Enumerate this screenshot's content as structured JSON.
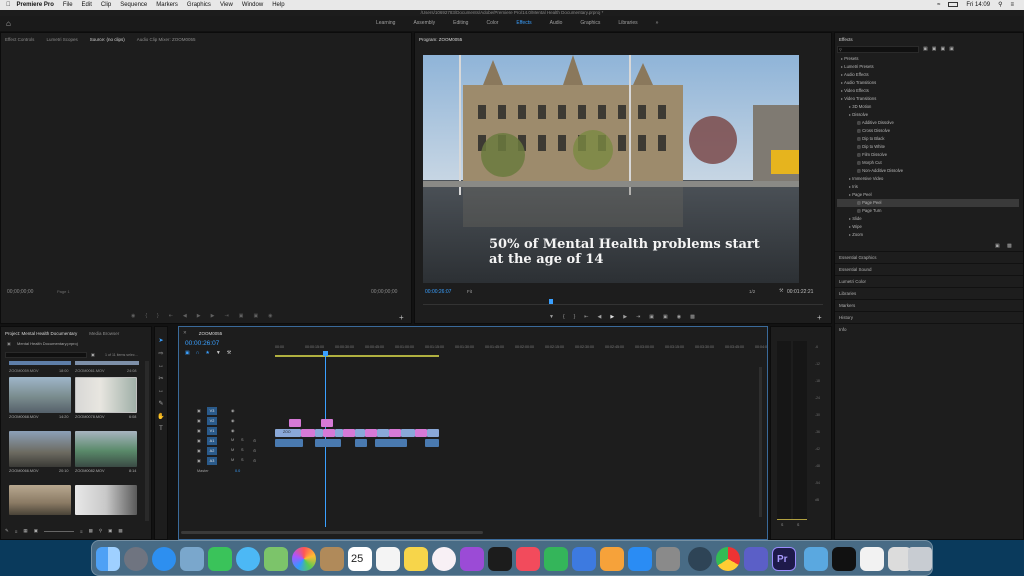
{
  "menubar": {
    "apple_icon": "apple-icon",
    "app_name": "Premiere Pro",
    "items": [
      "File",
      "Edit",
      "Clip",
      "Sequence",
      "Markers",
      "Graphics",
      "View",
      "Window",
      "Help"
    ],
    "clock": "Fri 14:09"
  },
  "titlebar": {
    "path": "/Users/10692783/Documents/Adobe/Premiere Pro/14.0/Mental Health Documentary.prproj *"
  },
  "workspace": {
    "tabs": [
      "Learning",
      "Assembly",
      "Editing",
      "Color",
      "Effects",
      "Audio",
      "Graphics",
      "Libraries"
    ],
    "active": "Effects",
    "more": "»"
  },
  "source_panel": {
    "tabs": [
      "Effect Controls",
      "Lumetri Scopes",
      "Source: (no clips)",
      "Audio Clip Mixer: ZOOM0055"
    ],
    "timecode_left": "00;00;00;00",
    "fit_label": "Page 1",
    "timecode_right": "00;00;00;00"
  },
  "program_panel": {
    "title": "Program: ZOOM0055",
    "overlay_text_line1": "50% of Mental Health problems start",
    "overlay_text_line2": "at the age of 14",
    "timecode": "00:00:26:07",
    "fit": "Fit",
    "resolution": "1/2",
    "duration": "00:01:22:21"
  },
  "effects_panel": {
    "title": "Effects",
    "tree": [
      {
        "label": "Presets",
        "indent": 0
      },
      {
        "label": "Lumetri Presets",
        "indent": 0
      },
      {
        "label": "Audio Effects",
        "indent": 0
      },
      {
        "label": "Audio Transitions",
        "indent": 0
      },
      {
        "label": "Video Effects",
        "indent": 0
      },
      {
        "label": "Video Transitions",
        "indent": 0
      },
      {
        "label": "3D Motion",
        "indent": 1
      },
      {
        "label": "Dissolve",
        "indent": 1
      },
      {
        "label": "Additive Dissolve",
        "indent": 2
      },
      {
        "label": "Cross Dissolve",
        "indent": 2
      },
      {
        "label": "Dip to Black",
        "indent": 2
      },
      {
        "label": "Dip to White",
        "indent": 2
      },
      {
        "label": "Film Dissolve",
        "indent": 2
      },
      {
        "label": "Morph Cut",
        "indent": 2
      },
      {
        "label": "Non-Additive Dissolve",
        "indent": 2
      },
      {
        "label": "Immersive Video",
        "indent": 1
      },
      {
        "label": "Iris",
        "indent": 1
      },
      {
        "label": "Page Peel",
        "indent": 1
      },
      {
        "label": "Page Peel",
        "indent": 2,
        "selected": true
      },
      {
        "label": "Page Turn",
        "indent": 2
      },
      {
        "label": "Slide",
        "indent": 1
      },
      {
        "label": "Wipe",
        "indent": 1
      },
      {
        "label": "Zoom",
        "indent": 1
      }
    ],
    "sections": [
      "Essential Graphics",
      "Essential Sound",
      "Lumetri Color",
      "Libraries",
      "Markers",
      "History",
      "Info"
    ]
  },
  "project_panel": {
    "tabs": [
      "Project: Mental Health Documentary",
      "Media Browser"
    ],
    "file": "Mental Health Documentary.prproj",
    "item_count": "1 of 11 items selec...",
    "clips": [
      {
        "name": "ZOOM0059.MOV",
        "duration": "18:00"
      },
      {
        "name": "ZOOM0061.MOV",
        "duration": ""
      },
      {
        "name": "ZOOM0068.MOV",
        "duration": "14:20"
      },
      {
        "name": "ZOOM0078.MOV",
        "duration": "6:08"
      },
      {
        "name": "ZOOM0066.MOV",
        "duration": "20:10"
      },
      {
        "name": "ZOOM0082.MOV",
        "duration": "8:14"
      },
      {
        "name": "",
        "duration": ""
      },
      {
        "name": "",
        "duration": ""
      }
    ],
    "top_durations": [
      "18:00",
      "24:08"
    ]
  },
  "timeline": {
    "title": "ZOOM0055",
    "timecode": "00:00:26:07",
    "ruler": [
      "00:00",
      "00:00:15:00",
      "00:00:30:00",
      "00:00:45:00",
      "00:01:00:00",
      "00:01:15:00",
      "00:01:30:00",
      "00:01:45:00",
      "00:02:00:00",
      "00:02:15:00",
      "00:02:30:00",
      "00:02:45:00",
      "00:03:00:00",
      "00:03:15:00",
      "00:03:30:00",
      "00:03:45:00",
      "00:04:0"
    ],
    "video_tracks": [
      "V3",
      "V2",
      "V1"
    ],
    "audio_tracks": [
      "A1",
      "A2",
      "A3"
    ],
    "master_label": "Master",
    "master_value": "0.0",
    "v1_clip_label": "ZOO"
  },
  "audio_meter": {
    "scale": [
      "-6",
      "-12",
      "-18",
      "-24",
      "-30",
      "-36",
      "-42",
      "-48",
      "-54",
      "dB"
    ],
    "labels": [
      "S",
      "S"
    ]
  },
  "dock": {
    "apps": [
      "finder-icon",
      "launchpad-icon",
      "safari-icon",
      "preview-icon",
      "facetime-icon",
      "messages-icon",
      "maps-icon",
      "photos-icon",
      "contacts-icon",
      "calendar-icon",
      "reminders-icon",
      "notes-icon",
      "music-icon",
      "podcasts-icon",
      "tv-icon",
      "news-icon",
      "numbers-icon",
      "keynote-icon",
      "pages-icon",
      "app-store-icon",
      "system-preferences-icon",
      "quicktime-icon",
      "chrome-icon",
      "teams-icon",
      "premiere-icon",
      "folder-icon",
      "trash-icon"
    ],
    "calendar_day": "25",
    "premiere_label": "Pr"
  }
}
